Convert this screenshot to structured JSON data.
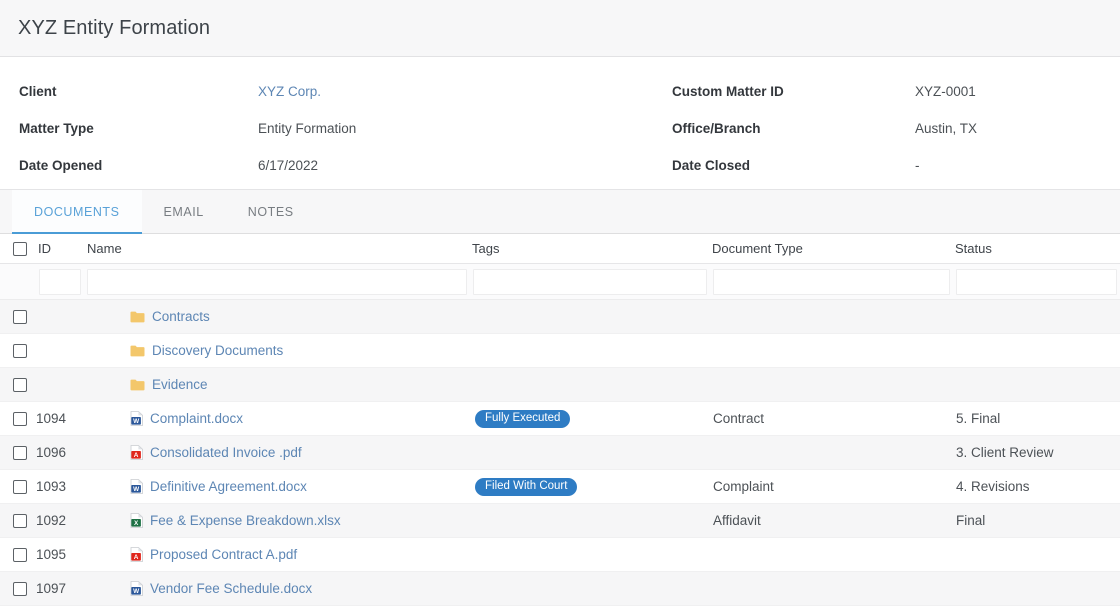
{
  "header": {
    "title": "XYZ Entity Formation"
  },
  "details": {
    "fields": [
      {
        "label": "Client",
        "value": "XYZ Corp.",
        "link": true
      },
      {
        "label": "Custom Matter ID",
        "value": "XYZ-0001",
        "link": false
      },
      {
        "label": "Matter Type",
        "value": "Entity Formation",
        "link": false
      },
      {
        "label": "Office/Branch",
        "value": "Austin, TX",
        "link": false
      },
      {
        "label": "Date Opened",
        "value": "6/17/2022",
        "link": false
      },
      {
        "label": "Date Closed",
        "value": "-",
        "link": false
      }
    ]
  },
  "tabs": [
    {
      "label": "DOCUMENTS",
      "active": true
    },
    {
      "label": "EMAIL",
      "active": false
    },
    {
      "label": "NOTES",
      "active": false
    }
  ],
  "table": {
    "columns": [
      {
        "key": "id",
        "label": "ID"
      },
      {
        "key": "name",
        "label": "Name"
      },
      {
        "key": "tags",
        "label": "Tags"
      },
      {
        "key": "type",
        "label": "Document Type"
      },
      {
        "key": "status",
        "label": "Status"
      }
    ],
    "select_all_checkbox": false,
    "filter_values": {
      "id": "",
      "name": "",
      "tags": "",
      "type": "",
      "status": ""
    },
    "rows": [
      {
        "checked": false,
        "id": "",
        "icon": "folder-icon",
        "name": "Contracts",
        "tag": "",
        "type": "",
        "status": ""
      },
      {
        "checked": false,
        "id": "",
        "icon": "folder-icon",
        "name": "Discovery Documents",
        "tag": "",
        "type": "",
        "status": ""
      },
      {
        "checked": false,
        "id": "",
        "icon": "folder-icon",
        "name": "Evidence",
        "tag": "",
        "type": "",
        "status": ""
      },
      {
        "checked": false,
        "id": "1094",
        "icon": "word-file-icon",
        "name": "Complaint.docx",
        "tag": "Fully Executed",
        "type": "Contract",
        "status": "5. Final"
      },
      {
        "checked": false,
        "id": "1096",
        "icon": "pdf-file-icon",
        "name": "Consolidated Invoice .pdf",
        "tag": "",
        "type": "",
        "status": "3. Client Review"
      },
      {
        "checked": false,
        "id": "1093",
        "icon": "word-file-icon",
        "name": "Definitive Agreement.docx",
        "tag": "Filed With Court",
        "type": "Complaint",
        "status": "4. Revisions"
      },
      {
        "checked": false,
        "id": "1092",
        "icon": "excel-file-icon",
        "name": "Fee & Expense Breakdown.xlsx",
        "tag": "",
        "type": "Affidavit",
        "status": "Final"
      },
      {
        "checked": false,
        "id": "1095",
        "icon": "pdf-file-icon",
        "name": "Proposed Contract A.pdf",
        "tag": "",
        "type": "",
        "status": ""
      },
      {
        "checked": false,
        "id": "1097",
        "icon": "word-file-icon",
        "name": "Vendor Fee Schedule.docx",
        "tag": "",
        "type": "",
        "status": ""
      }
    ]
  },
  "colors": {
    "accent": "#4a9cd6",
    "link": "#5d86b4",
    "badge": "#2e7cc4",
    "folder": "#f3c76b",
    "word": "#2b579a",
    "pdf": "#e0261c",
    "excel": "#1e7145",
    "row_alt": "#f6f6f7",
    "titlebar": "#f7f7f8"
  }
}
